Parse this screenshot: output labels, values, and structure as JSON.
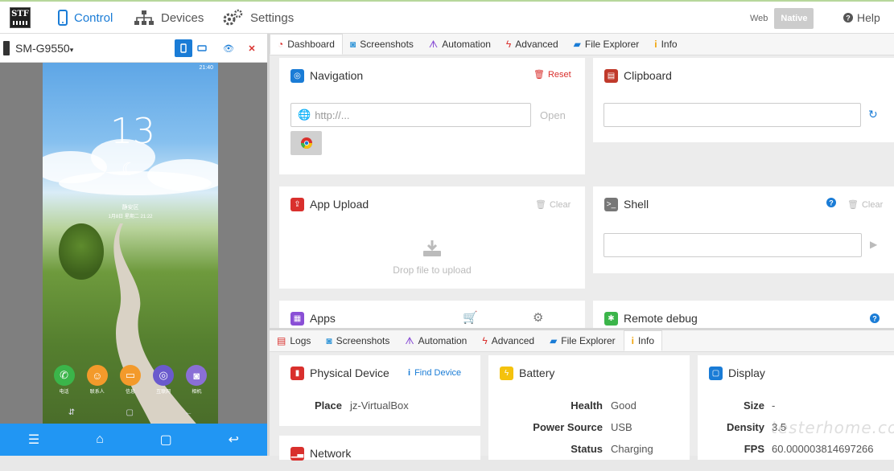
{
  "header": {
    "logo_text": "STF",
    "nav": [
      {
        "label": "Control"
      },
      {
        "label": "Devices"
      },
      {
        "label": "Settings"
      }
    ],
    "view_modes": [
      "Web",
      "Native"
    ],
    "selected_view": "Native",
    "help_label": "Help"
  },
  "device": {
    "name": "SM-G9550",
    "clock": "13",
    "location": "静安区",
    "date": "1月8日 星期二 21:22",
    "status_time": "21:40",
    "dock": [
      {
        "label": "电话",
        "color": "#3bb54a",
        "icon": "phone-icon"
      },
      {
        "label": "联系人",
        "color": "#f39a2b",
        "icon": "contacts-icon"
      },
      {
        "label": "信息",
        "color": "#f39a2b",
        "icon": "message-icon"
      },
      {
        "label": "互联网",
        "color": "#6a5acd",
        "icon": "internet-icon"
      },
      {
        "label": "相机",
        "color": "#8a6fd6",
        "icon": "camera-icon"
      }
    ]
  },
  "top_tabs": [
    {
      "label": "Dashboard",
      "icon": "dashboard-icon",
      "color": "#d9302d"
    },
    {
      "label": "Screenshots",
      "icon": "camera-icon",
      "color": "#3b9ad9"
    },
    {
      "label": "Automation",
      "icon": "automation-icon",
      "color": "#8a4fd6"
    },
    {
      "label": "Advanced",
      "icon": "bolt-icon",
      "color": "#d9302d"
    },
    {
      "label": "File Explorer",
      "icon": "folder-icon",
      "color": "#1a7cd6"
    },
    {
      "label": "Info",
      "icon": "info-icon",
      "color": "#f0a30a"
    }
  ],
  "dashboard": {
    "navigation": {
      "title": "Navigation",
      "reset_label": "Reset",
      "url_placeholder": "http://...",
      "open_label": "Open"
    },
    "clipboard": {
      "title": "Clipboard"
    },
    "app_upload": {
      "title": "App Upload",
      "clear_label": "Clear",
      "drop_text": "Drop file to upload"
    },
    "shell": {
      "title": "Shell",
      "clear_label": "Clear"
    },
    "apps": {
      "title": "Apps"
    },
    "remote_debug": {
      "title": "Remote debug"
    }
  },
  "bottom_tabs": [
    {
      "label": "Logs",
      "icon": "logs-icon",
      "color": "#d9302d"
    },
    {
      "label": "Screenshots",
      "icon": "camera-icon",
      "color": "#3b9ad9"
    },
    {
      "label": "Automation",
      "icon": "automation-icon",
      "color": "#8a4fd6"
    },
    {
      "label": "Advanced",
      "icon": "bolt-icon",
      "color": "#d9302d"
    },
    {
      "label": "File Explorer",
      "icon": "folder-icon",
      "color": "#1a7cd6"
    },
    {
      "label": "Info",
      "icon": "info-icon",
      "color": "#f0a30a"
    }
  ],
  "info": {
    "physical_device": {
      "title": "Physical Device",
      "find_label": "Find Device",
      "place_key": "Place",
      "place_value": "jz-VirtualBox"
    },
    "battery": {
      "title": "Battery",
      "rows": [
        {
          "key": "Health",
          "value": "Good"
        },
        {
          "key": "Power Source",
          "value": "USB"
        },
        {
          "key": "Status",
          "value": "Charging"
        }
      ]
    },
    "display": {
      "title": "Display",
      "rows": [
        {
          "key": "Size",
          "value": "-"
        },
        {
          "key": "Density",
          "value": "3.5"
        },
        {
          "key": "FPS",
          "value": "60.000003814697266"
        }
      ]
    },
    "network": {
      "title": "Network"
    }
  },
  "watermark": "testerhome.com"
}
